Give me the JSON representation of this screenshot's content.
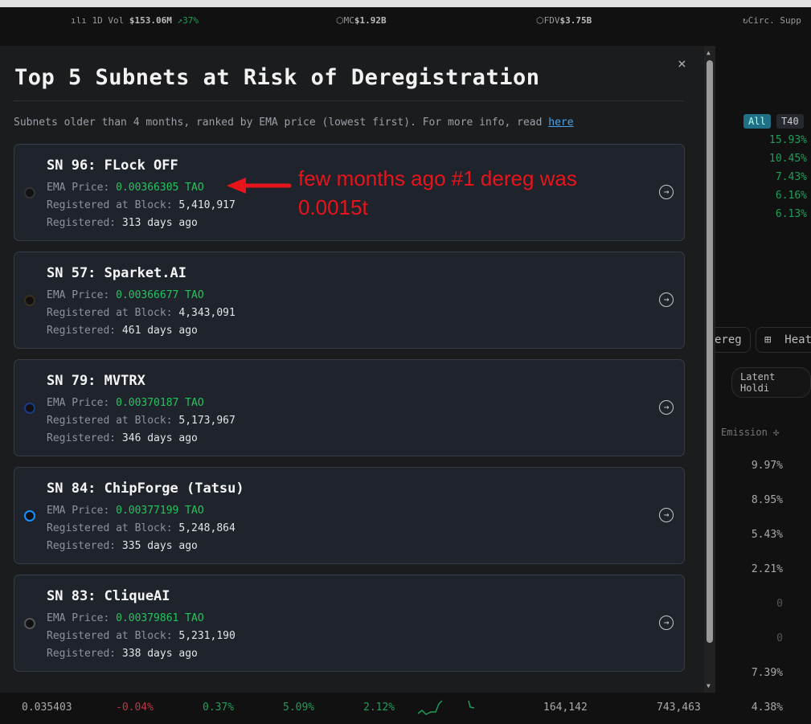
{
  "statsbar": {
    "vol_label": "1D Vol",
    "vol_value": "$153.06M",
    "vol_change": "37%",
    "mc_label": "MC",
    "mc_value": "$1.92B",
    "fdv_label": "FDV",
    "fdv_value": "$3.75B",
    "circ_label": "Circ. Supp"
  },
  "background": {
    "filters": {
      "all": "All",
      "t40": "T40"
    },
    "top_percents": [
      "15.93%",
      "10.45%",
      "7.43%",
      "6.16%",
      "6.13%"
    ],
    "dereg_btn": "ereg",
    "heat_btn": "Heat",
    "latent_btn": "Latent Holdi",
    "emission_header": "Emission",
    "emission_values": [
      "9.97%",
      "8.95%",
      "5.43%",
      "2.21%",
      "0",
      "0",
      "7.39%",
      "4.38%"
    ],
    "bottom_row": {
      "price": "0.035403",
      "c1": "-0.04%",
      "c2": "0.37%",
      "c3": "5.09%",
      "c4": "2.12%",
      "v1": "164,142",
      "v2": "743,463"
    }
  },
  "modal": {
    "title": "Top 5 Subnets at Risk of Deregistration",
    "subtitle": "Subnets older than 4 months, ranked by EMA price (lowest first). For more info, read ",
    "subtitle_link": "here",
    "close": "×",
    "labels": {
      "ema": "EMA Price: ",
      "block": "Registered at Block: ",
      "registered": "Registered: "
    },
    "subnets": [
      {
        "name": "SN 96: FLock OFF",
        "ema": "0.00366305 TAO",
        "block": "5,410,917",
        "age": "313 days ago"
      },
      {
        "name": "SN 57: Sparket.AI",
        "ema": "0.00366677 TAO",
        "block": "4,343,091",
        "age": "461 days ago"
      },
      {
        "name": "SN 79: MVTRX",
        "ema": "0.00370187 TAO",
        "block": "5,173,967",
        "age": "346 days ago"
      },
      {
        "name": "SN 84: ChipForge (Tatsu)",
        "ema": "0.00377199 TAO",
        "block": "5,248,864",
        "age": "335 days ago"
      },
      {
        "name": "SN 83: CliqueAI",
        "ema": "0.00379861 TAO",
        "block": "5,231,190",
        "age": "338 days ago"
      }
    ]
  },
  "annotation": {
    "line1": "few months ago #1 dereg was",
    "line2": "0.0015t"
  }
}
